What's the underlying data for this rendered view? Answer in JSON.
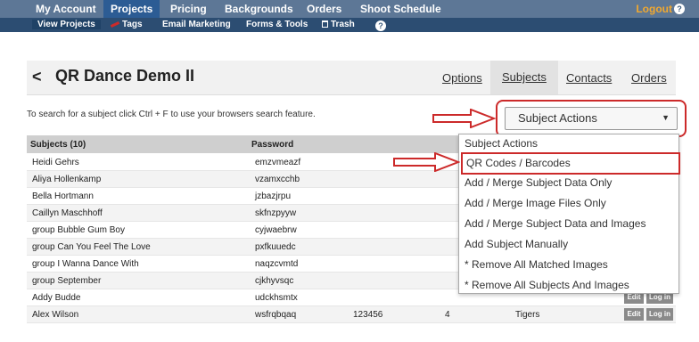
{
  "top_nav": {
    "items": [
      {
        "label": "My Account"
      },
      {
        "label": "Projects"
      },
      {
        "label": "Pricing"
      },
      {
        "label": "Backgrounds"
      },
      {
        "label": "Orders"
      },
      {
        "label": "Shoot Schedule"
      }
    ],
    "logout_label": "Logout",
    "help_glyph": "?"
  },
  "sub_nav": {
    "items": [
      {
        "label": "View Projects"
      },
      {
        "label": "Tags"
      },
      {
        "label": "Email Marketing"
      },
      {
        "label": "Forms & Tools"
      },
      {
        "label": "Trash"
      }
    ],
    "help_glyph": "?"
  },
  "page": {
    "back_glyph": "<",
    "title": "QR Dance Demo II",
    "tabs": [
      {
        "label": "Options"
      },
      {
        "label": "Subjects"
      },
      {
        "label": "Contacts"
      },
      {
        "label": "Orders"
      }
    ],
    "active_tab": "Subjects"
  },
  "hint_text": "To search for a subject click Ctrl + F to use your browsers search feature.",
  "subject_actions": {
    "selected": "Subject Actions",
    "options": [
      {
        "label": "Subject Actions"
      },
      {
        "label": "QR Codes / Barcodes"
      },
      {
        "label": "Add / Merge Subject Data Only"
      },
      {
        "label": "Add / Merge Image Files Only"
      },
      {
        "label": "Add / Merge Subject Data and Images"
      },
      {
        "label": "Add Subject Manually"
      },
      {
        "label": "* Remove All Matched Images"
      },
      {
        "label": "* Remove All Subjects And Images"
      }
    ],
    "highlighted": "QR Codes / Barcodes"
  },
  "table": {
    "headers": {
      "subjects": "Subjects (10)",
      "password": "Password"
    },
    "rows": [
      {
        "name": "Heidi Gehrs",
        "password": "emzvmeazf"
      },
      {
        "name": "Aliya Hollenkamp",
        "password": "vzamxcchb"
      },
      {
        "name": "Bella Hortmann",
        "password": "jzbazjrpu"
      },
      {
        "name": "Caillyn Maschhoff",
        "password": "skfnzpyyw"
      },
      {
        "name": "group Bubble Gum Boy",
        "password": "cyjwaebrw"
      },
      {
        "name": "group Can You Feel The Love",
        "password": "pxfkuuedc"
      },
      {
        "name": "group I Wanna Dance With",
        "password": "naqzcvmtd"
      },
      {
        "name": "group September",
        "password": "cjkhyvsqc"
      },
      {
        "name": "Addy Budde",
        "password": "udckhsmtx",
        "edit": "Edit",
        "login": "Log in"
      },
      {
        "name": "Alex Wilson",
        "password": "wsfrqbqaq",
        "extra1": "123456",
        "extra2": "4",
        "extra3": "Tigers",
        "edit": "Edit",
        "login": "Log in"
      }
    ]
  },
  "colors": {
    "nav_top": "#5d7796",
    "nav_bottom": "#2c4d72",
    "logout": "#f0a830",
    "annotation_red": "#cc2a2a"
  }
}
